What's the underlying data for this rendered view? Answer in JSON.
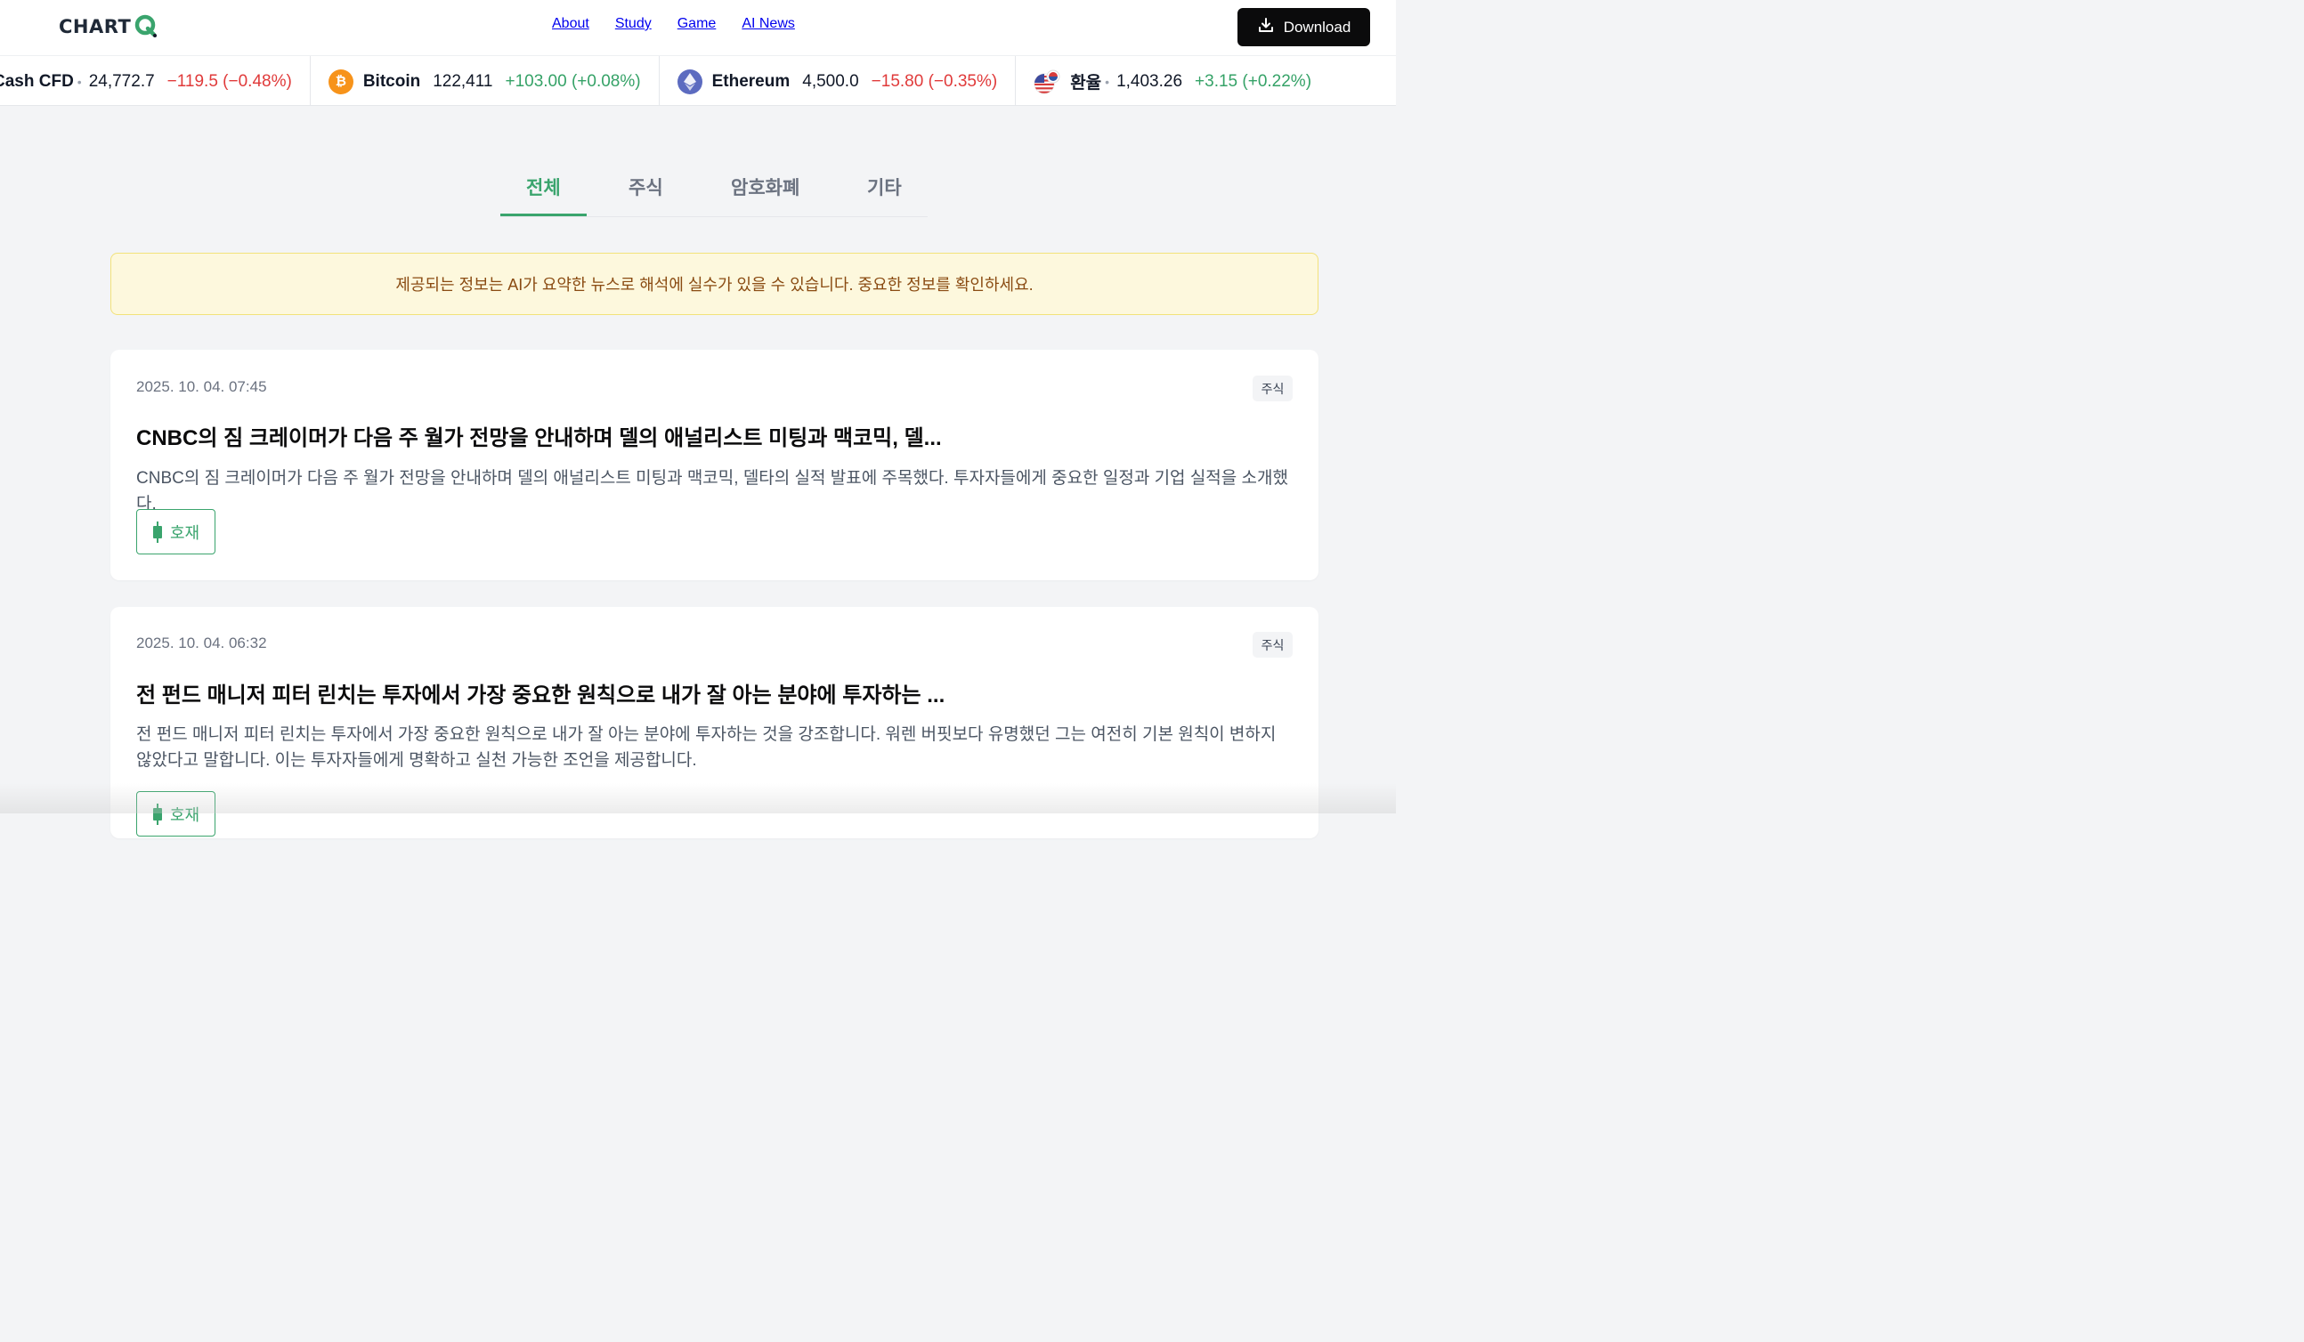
{
  "header": {
    "logo_text": "CHART",
    "nav": [
      "About",
      "Study",
      "Game",
      "AI News"
    ],
    "download_label": "Download"
  },
  "ticker": [
    {
      "name": "Cash CFD",
      "dot": "•",
      "price": "24,772.7",
      "change": "−119.5 (−0.48%)",
      "direction": "down",
      "icon": null
    },
    {
      "name": "Bitcoin",
      "price": "122,411",
      "change": "+103.00 (+0.08%)",
      "direction": "up",
      "icon": "bitcoin-icon"
    },
    {
      "name": "Ethereum",
      "price": "4,500.0",
      "change": "−15.80 (−0.35%)",
      "direction": "down",
      "icon": "ethereum-icon"
    },
    {
      "name": "환율",
      "dot": "•",
      "price": "1,403.26",
      "change": "+3.15 (+0.22%)",
      "direction": "up",
      "icon": "usd-krw-flag-icon"
    }
  ],
  "tabs": [
    "전체",
    "주식",
    "암호화폐",
    "기타"
  ],
  "active_tab": "전체",
  "notice": "제공되는 정보는 AI가 요약한 뉴스로 해석에 실수가 있을 수 있습니다. 중요한 정보를 확인하세요.",
  "news": [
    {
      "date": "2025. 10. 04. 07:45",
      "category": "주식",
      "title": "CNBC의 짐 크레이머가 다음 주 월가 전망을 안내하며 델의 애널리스트 미팅과 맥코믹, 델...",
      "summary": "CNBC의 짐 크레이머가 다음 주 월가 전망을 안내하며 델의 애널리스트 미팅과 맥코믹, 델타의 실적 발표에 주목했다. 투자자들에게 중요한 일정과 기업 실적을 소개했다.",
      "sentiment": "호재"
    },
    {
      "date": "2025. 10. 04. 06:32",
      "category": "주식",
      "title": "전 펀드 매니저 피터 린치는 투자에서 가장 중요한 원칙으로 내가 잘 아는 분야에 투자하는 ...",
      "summary": "전 펀드 매니저 피터 린치는 투자에서 가장 중요한 원칙으로 내가 잘 아는 분야에 투자하는 것을 강조합니다. 워렌 버핏보다 유명했던 그는 여전히 기본 원칙이 변하지 않았다고 말합니다. 이는 투자자들에게 명확하고 실천 가능한 조언을 제공합니다.",
      "sentiment": "호재"
    }
  ],
  "colors": {
    "accent": "#3aa46d",
    "down": "#e03a3a",
    "notice_bg": "#fdf8dd",
    "notice_text": "#8a4b12"
  }
}
